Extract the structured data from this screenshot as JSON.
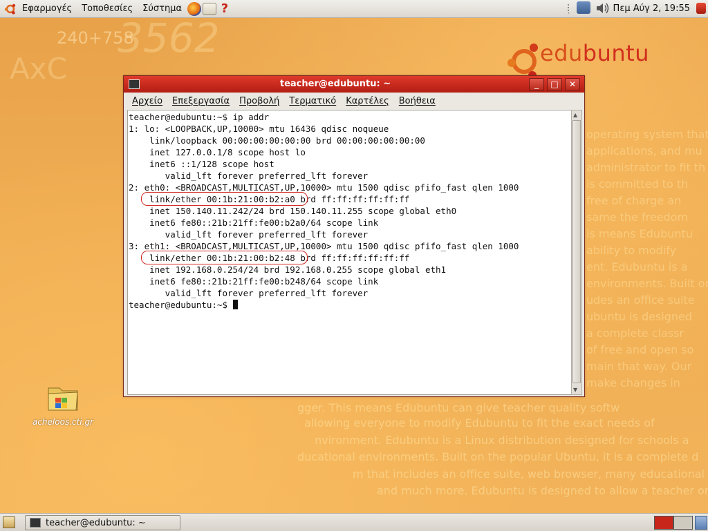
{
  "top_panel": {
    "menus": [
      "Εφαρμογές",
      "Τοποθεσίες",
      "Σύστημα"
    ],
    "clock": "Πεμ Αύγ  2, 19:55"
  },
  "desktop": {
    "logo_text_1": "edu",
    "logo_text_2": "buntu",
    "deco_number": "240+758",
    "deco_big": "3562",
    "deco_axc": "AxC",
    "icon_label": "acheloos.cti.gr",
    "bg_lines": [
      "gger. This means Edubuntu can give teacher quality softw",
      "allowing everyone to modify Edubuntu to fit the exact needs of",
      "nvironment. Edubuntu is a Linux distribution designed for schools a",
      "ducational environments. Built on the popular Ubuntu, it is a complete d",
      "m that includes an office suite, web browser, many educational appl",
      "and much more. Edubuntu is designed to allow a teacher or network"
    ],
    "bg_right_lines": [
      "operating system that",
      "applications, and mu",
      "administrator to fit th",
      "is committed to th",
      "free of charge an",
      "same the freedom",
      "is means Edubuntu",
      "ability to modify",
      "ent. Edubuntu is a",
      "environments. Built on",
      "udes an office suite",
      "ubuntu is designed",
      "a complete classr",
      "of free and open so",
      "main that way. Our",
      "make changes in"
    ]
  },
  "terminal": {
    "title": "teacher@edubuntu: ~",
    "menus": [
      "Αρχείο",
      "Επεξεργασία",
      "Προβολή",
      "Τερματικό",
      "Καρτέλες",
      "Βοήθεια"
    ],
    "lines": [
      "teacher@edubuntu:~$ ip addr",
      "1: lo: <LOOPBACK,UP,10000> mtu 16436 qdisc noqueue",
      "    link/loopback 00:00:00:00:00:00 brd 00:00:00:00:00:00",
      "    inet 127.0.0.1/8 scope host lo",
      "    inet6 ::1/128 scope host",
      "       valid_lft forever preferred_lft forever",
      "2: eth0: <BROADCAST,MULTICAST,UP,10000> mtu 1500 qdisc pfifo_fast qlen 1000",
      "    link/ether 00:1b:21:00:b2:a0 brd ff:ff:ff:ff:ff:ff",
      "    inet 150.140.11.242/24 brd 150.140.11.255 scope global eth0",
      "    inet6 fe80::21b:21ff:fe00:b2a0/64 scope link",
      "       valid_lft forever preferred_lft forever",
      "3: eth1: <BROADCAST,MULTICAST,UP,10000> mtu 1500 qdisc pfifo_fast qlen 1000",
      "    link/ether 00:1b:21:00:b2:48 brd ff:ff:ff:ff:ff:ff",
      "    inet 192.168.0.254/24 brd 192.168.0.255 scope global eth1",
      "    inet6 fe80::21b:21ff:fe00:b248/64 scope link",
      "       valid_lft forever preferred_lft forever"
    ],
    "prompt": "teacher@edubuntu:~$ "
  },
  "bottom_panel": {
    "task_label": "teacher@edubuntu: ~"
  },
  "colors": {
    "titlebar": "#c8261a",
    "desktop": "#eda64c",
    "logo": "#d84d1b"
  }
}
